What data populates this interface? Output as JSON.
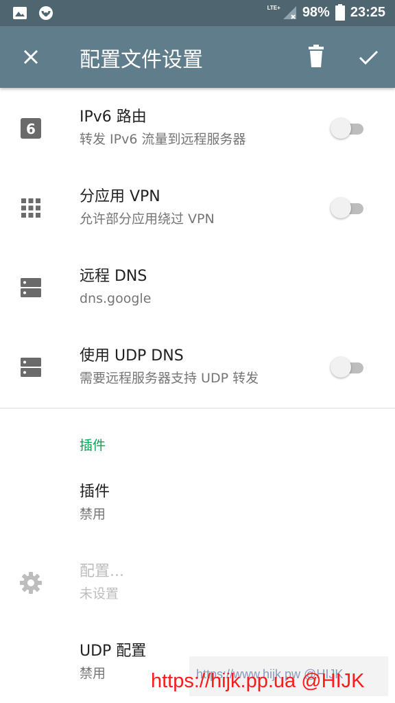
{
  "status_bar": {
    "network": "LTE+",
    "battery": "98%",
    "time": "23:25",
    "icons": [
      "image-icon",
      "app-notification-icon",
      "signal-icon",
      "battery-icon"
    ]
  },
  "app_bar": {
    "title": "配置文件设置",
    "background": "#607d8b",
    "icons": [
      "close-icon",
      "delete-icon",
      "check-icon"
    ]
  },
  "settings": [
    {
      "title": "IPv6 路由",
      "subtitle": "转发 IPv6 流量到远程服务器",
      "icon": "ipv6-icon",
      "toggle": false
    },
    {
      "title": "分应用 VPN",
      "subtitle": "允许部分应用绕过 VPN",
      "icon": "apps-grid-icon",
      "toggle": false
    },
    {
      "title": "远程 DNS",
      "subtitle": "dns.google",
      "icon": "dns-server-icon"
    },
    {
      "title": "使用 UDP DNS",
      "subtitle": "需要远程服务器支持 UDP 转发",
      "icon": "dns-server-icon",
      "toggle": false
    }
  ],
  "plugin_section": {
    "header": "插件",
    "accent": "#00a651",
    "items": [
      {
        "title": "插件",
        "subtitle": "禁用"
      },
      {
        "title": "配置...",
        "subtitle": "未设置",
        "icon": "gear-icon",
        "disabled": true
      },
      {
        "title": "UDP 配置",
        "subtitle": "禁用"
      }
    ]
  },
  "watermark": {
    "gray_text": "https://www.hijk.pw @HIJK",
    "red_text": "https://hijk.pp.ua @HIJK"
  }
}
